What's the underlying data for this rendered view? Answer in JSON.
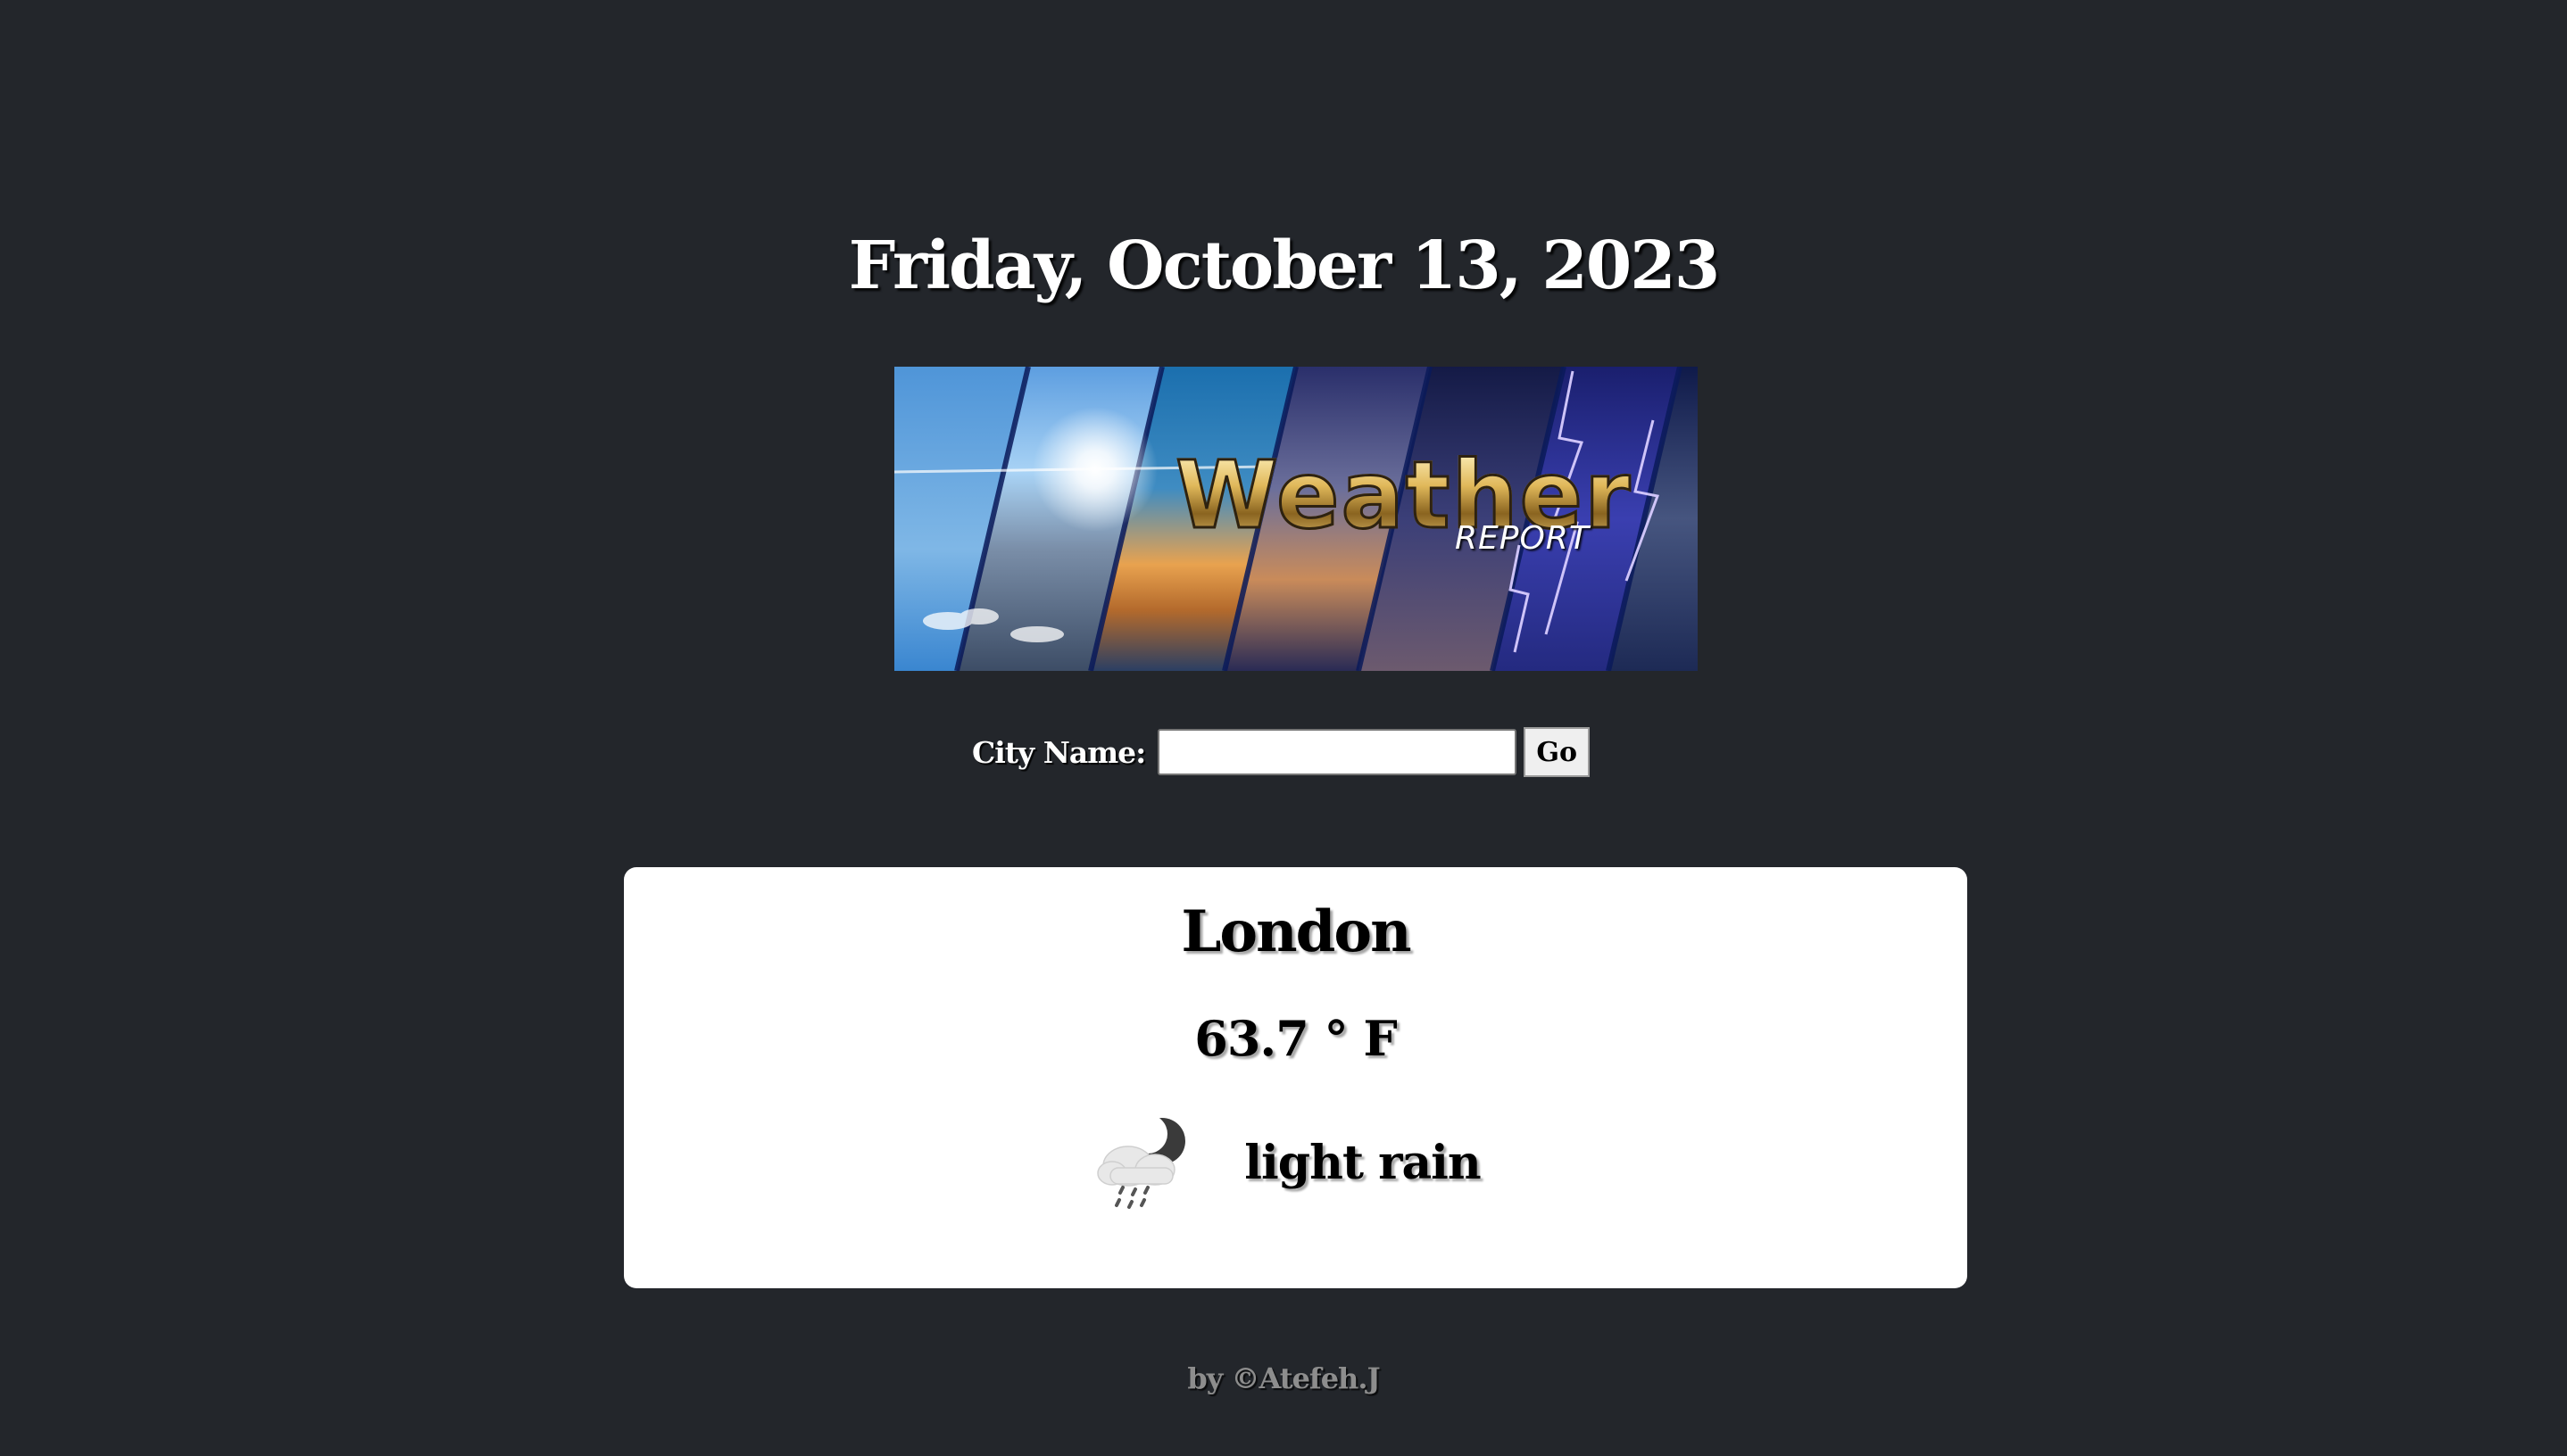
{
  "header": {
    "date": "Friday, October 13, 2023"
  },
  "banner": {
    "title": "Weather",
    "subtitle": "REPORT",
    "image": "weather-report-banner"
  },
  "search": {
    "label": "City Name:",
    "value": "",
    "placeholder": "",
    "button_label": "Go"
  },
  "weather": {
    "city": "London",
    "temperature": "63.7 ° F",
    "condition": "light rain",
    "icon": "night-light-rain-icon"
  },
  "footer": {
    "credit": "by ©Atefeh.J"
  },
  "colors": {
    "background": "#23262b",
    "card": "#ffffff",
    "footer_text": "#8d8d8d"
  }
}
